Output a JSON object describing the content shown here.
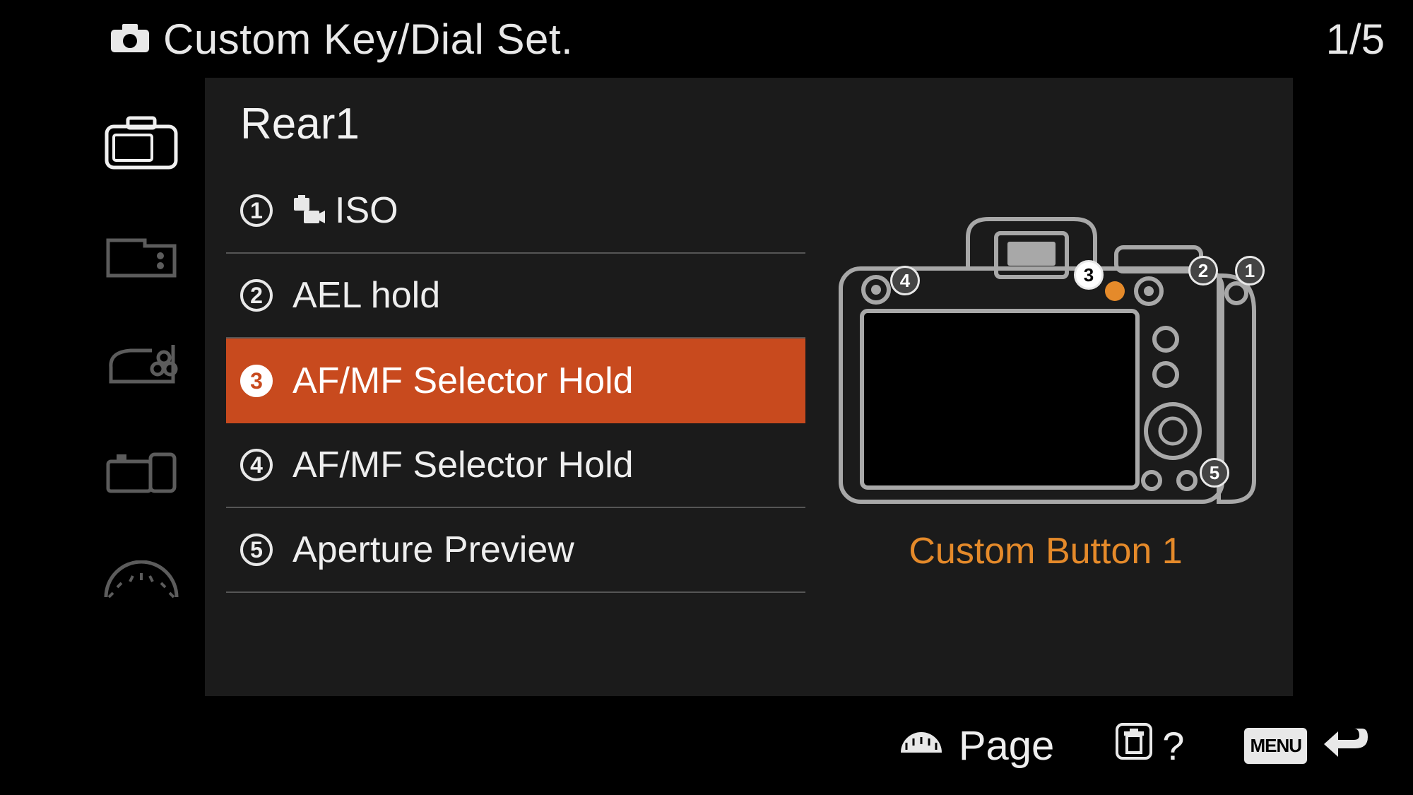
{
  "header": {
    "title": "Custom Key/Dial Set.",
    "page_current": 1,
    "page_total": 5
  },
  "panel": {
    "title": "Rear1"
  },
  "items": [
    {
      "num": "1",
      "label": "ISO",
      "has_icon": true,
      "selected": false
    },
    {
      "num": "2",
      "label": "AEL hold",
      "has_icon": false,
      "selected": false
    },
    {
      "num": "3",
      "label": "AF/MF Selector Hold",
      "has_icon": false,
      "selected": true
    },
    {
      "num": "4",
      "label": "AF/MF Selector Hold",
      "has_icon": false,
      "selected": false
    },
    {
      "num": "5",
      "label": "Aperture Preview",
      "has_icon": false,
      "selected": false
    }
  ],
  "diagram": {
    "caption": "Custom Button 1",
    "active_number": 3
  },
  "footer": {
    "page_label": "Page",
    "help_label": "?",
    "menu_label": "MENU"
  },
  "colors": {
    "highlight": "#c84a1e",
    "accent": "#e58a2a"
  }
}
